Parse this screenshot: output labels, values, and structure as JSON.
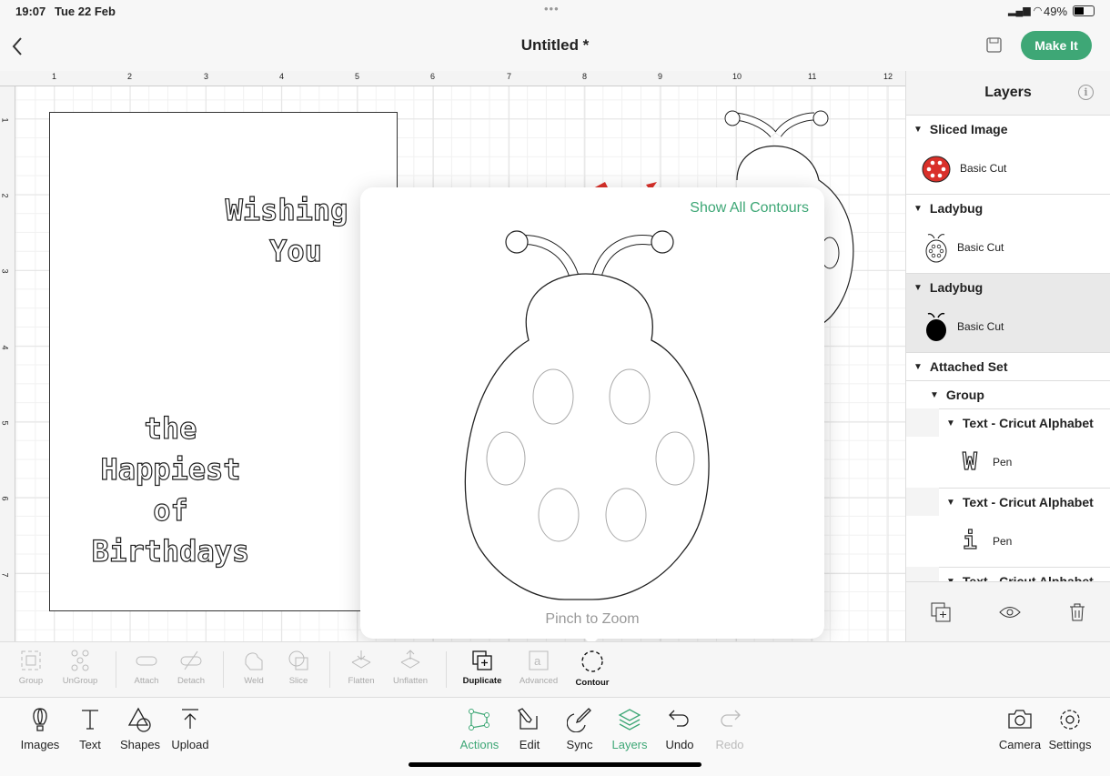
{
  "status": {
    "time": "19:07",
    "date": "Tue 22 Feb",
    "battery": "49%"
  },
  "header": {
    "title": "Untitled *",
    "make_it": "Make It"
  },
  "ruler": {
    "top": [
      "1",
      "2",
      "3",
      "4",
      "5",
      "6",
      "7",
      "8",
      "9",
      "10",
      "11",
      "12"
    ],
    "left": [
      "1",
      "2",
      "3",
      "4",
      "5",
      "6",
      "7"
    ]
  },
  "card": {
    "lines1": [
      "Wishing",
      "You"
    ],
    "lines2": [
      "the",
      "Happiest",
      "of",
      "Birthdays"
    ]
  },
  "popup": {
    "show_all": "Show All Contours",
    "hint": "Pinch to Zoom"
  },
  "layers": {
    "title": "Layers",
    "items": [
      {
        "name": "Sliced Image",
        "sub": "Basic Cut",
        "icon": "ladybug-red-icon"
      },
      {
        "name": "Ladybug",
        "sub": "Basic Cut",
        "icon": "ladybug-outline-icon"
      },
      {
        "name": "Ladybug",
        "sub": "Basic Cut",
        "icon": "ladybug-black-icon",
        "selected": true
      }
    ],
    "attached": "Attached Set",
    "group": "Group",
    "texts": [
      {
        "name": "Text - Cricut Alphabet",
        "sub": "Pen",
        "glyph": "W"
      },
      {
        "name": "Text - Cricut Alphabet",
        "sub": "Pen",
        "glyph": "i"
      },
      {
        "name": "Text - Cricut Alphabet"
      }
    ]
  },
  "actions": [
    "Group",
    "UnGroup",
    "Attach",
    "Detach",
    "Weld",
    "Slice",
    "Flatten",
    "Unflatten",
    "Duplicate",
    "Advanced",
    "Contour"
  ],
  "toolbar": {
    "left": [
      "Images",
      "Text",
      "Shapes",
      "Upload"
    ],
    "center": [
      "Actions",
      "Edit",
      "Sync",
      "Layers",
      "Undo",
      "Redo"
    ],
    "right": [
      "Camera",
      "Settings"
    ]
  },
  "colors": {
    "accent": "#3ea776",
    "ladybug_red": "#d9302a"
  }
}
